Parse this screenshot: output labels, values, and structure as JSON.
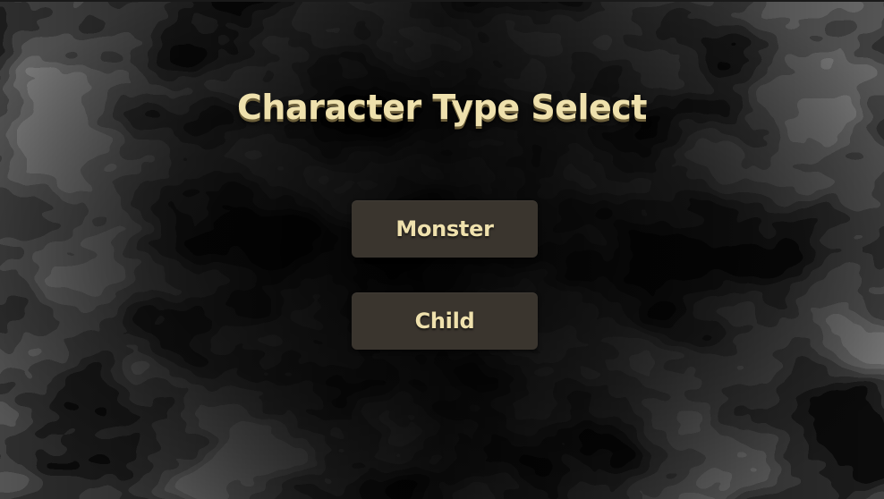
{
  "screen": {
    "title": "Character Type Select",
    "background": "dark-smoke-texture"
  },
  "menu": {
    "buttons": [
      {
        "id": "monster",
        "label": "Monster"
      },
      {
        "id": "child",
        "label": "Child"
      }
    ]
  },
  "colors": {
    "title_text": "#efe1ad",
    "button_bg": "#3a352e",
    "button_text": "#efe1ad",
    "background": "#0a0a0a"
  }
}
